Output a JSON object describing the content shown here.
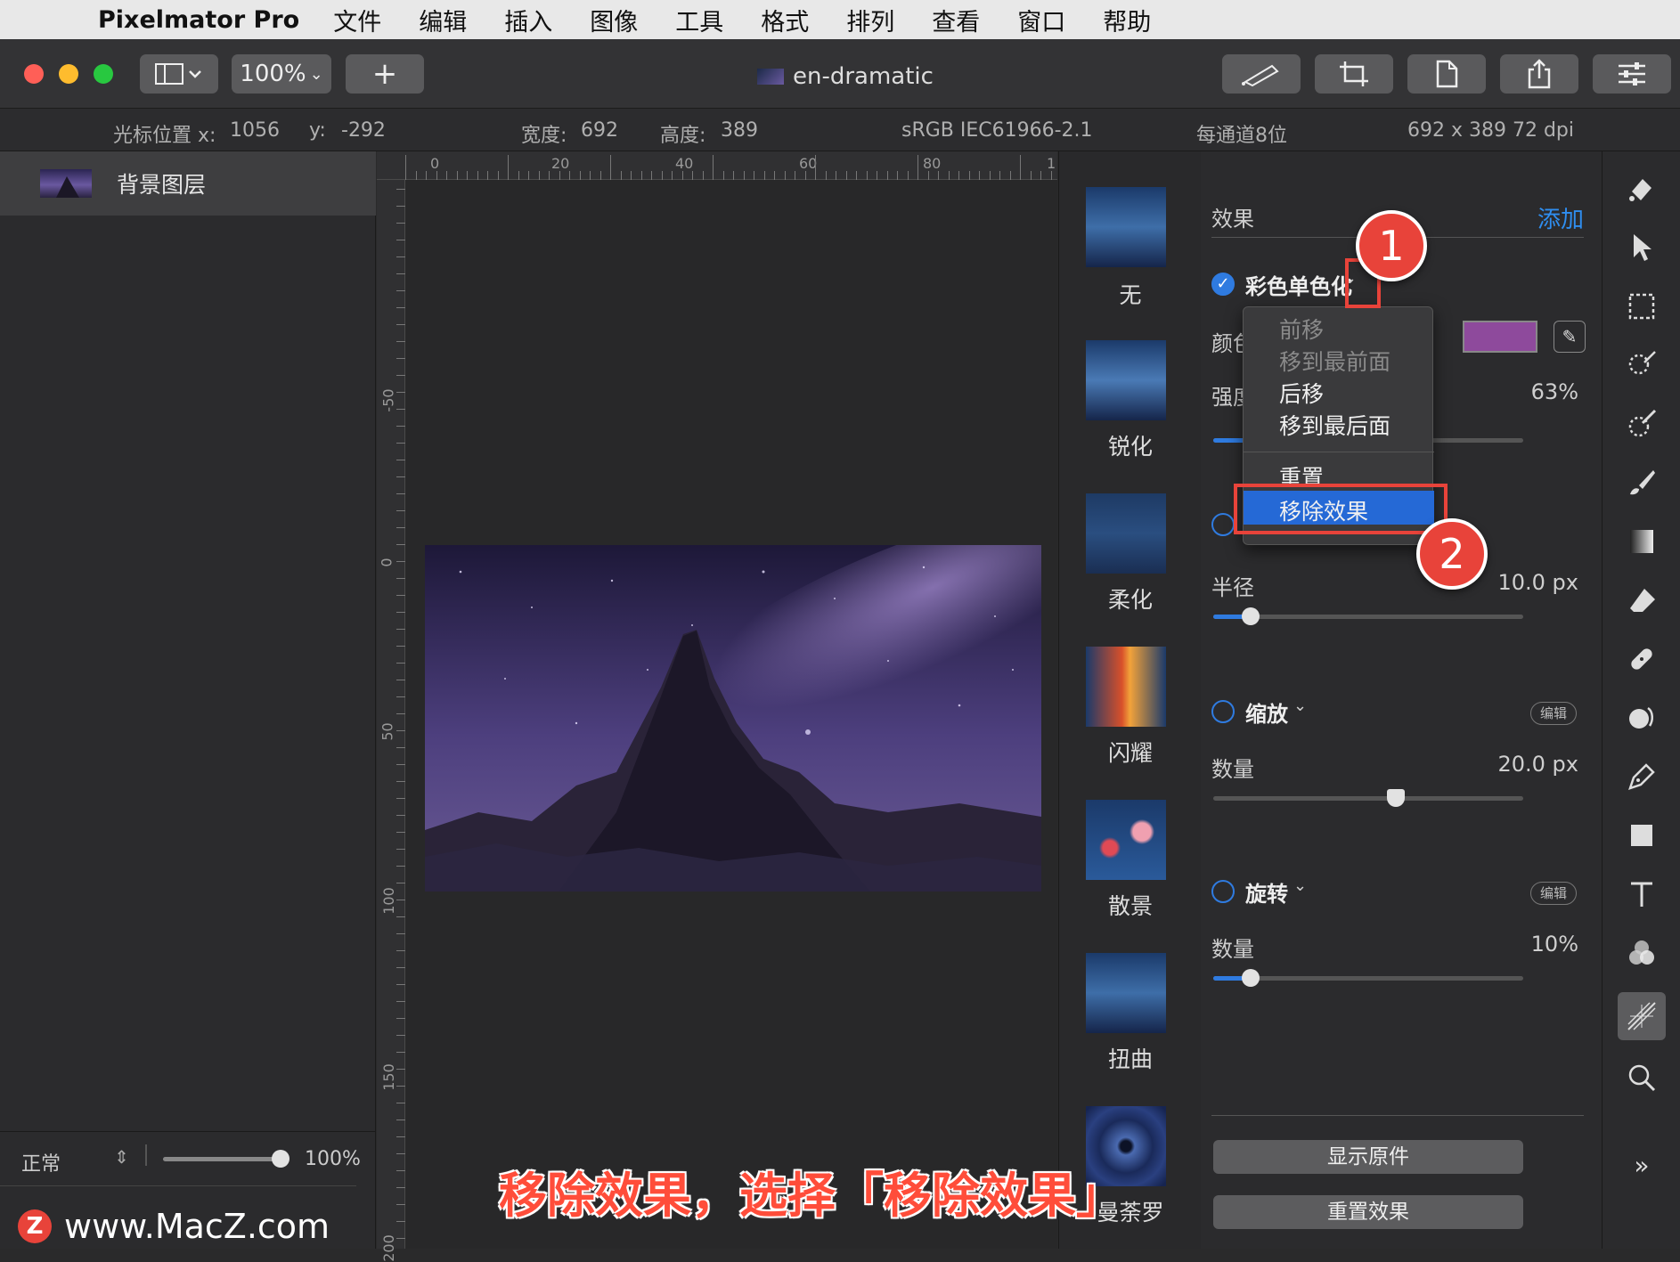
{
  "menubar": {
    "app_name": "Pixelmator Pro",
    "menus": [
      "文件",
      "编辑",
      "插入",
      "图像",
      "工具",
      "格式",
      "排列",
      "查看",
      "窗口",
      "帮助"
    ]
  },
  "toolbar": {
    "zoom": "100%",
    "add": "+",
    "document_title": "en-dramatic"
  },
  "infobar": {
    "cursor_label": "光标位置 x:",
    "cursor_x": "1056",
    "y_label": "y:",
    "cursor_y": "-292",
    "width_label": "宽度:",
    "width": "692",
    "height_label": "高度:",
    "height": "389",
    "color_profile": "sRGB IEC61966-2.1",
    "bit_depth": "每通道8位",
    "dimensions": "692 x 389 72 dpi"
  },
  "layers": {
    "layer_name": "背景图层",
    "blend_mode": "正常",
    "opacity": "100%",
    "opacity_value": 1.0
  },
  "ruler": {
    "top_marks": [
      "0",
      "20",
      "40",
      "60",
      "80",
      "1"
    ],
    "left_marks": [
      "-50",
      "0",
      "50",
      "100",
      "150",
      "200"
    ]
  },
  "browser": {
    "presets": [
      "无",
      "锐化",
      "柔化",
      "闪耀",
      "散景",
      "扭曲",
      "曼荼罗"
    ]
  },
  "panel": {
    "header": "效果",
    "add": "添加",
    "effect1": {
      "name": "彩色单色化",
      "color_label": "颜色",
      "color": "#8e4a9c",
      "intensity_label": "强度",
      "intensity_value": "63%",
      "intensity": 0.63
    },
    "effect2": {
      "radius_label": "半径",
      "radius_value": "10.0 px",
      "radius": 0.12
    },
    "effect3": {
      "name": "缩放",
      "edit": "编辑",
      "amount_label": "数量",
      "amount_value": "20.0 px",
      "amount": 0.59
    },
    "effect4": {
      "name": "旋转",
      "edit": "编辑",
      "amount_label": "数量",
      "amount_value": "10%",
      "amount": 0.12
    },
    "show_original": "显示原件",
    "reset_effects": "重置效果"
  },
  "dropdown": {
    "items": [
      "前移",
      "移到最前面",
      "后移",
      "移到最后面",
      "重置",
      "移除效果"
    ]
  },
  "annotations": {
    "step1": "1",
    "step2": "2",
    "caption": "移除效果，选择「移除效果」",
    "watermark_logo": "Z",
    "watermark": "www.MacZ.com"
  },
  "colors": {
    "accent": "#2f7be0",
    "annotation_red": "#e8433a"
  }
}
